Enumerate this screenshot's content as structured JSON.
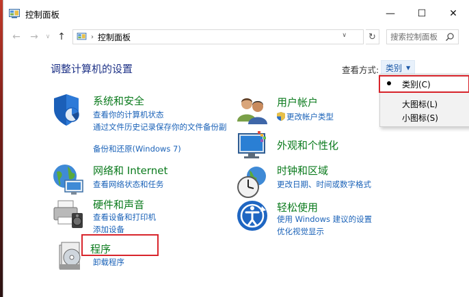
{
  "window": {
    "title": "控制面板"
  },
  "caption": {
    "minimize": "—",
    "maximize": "☐",
    "close": "✕"
  },
  "nav": {
    "back": "←",
    "forward": "→",
    "recent": "∨",
    "up": "↑",
    "address_sep": "›",
    "address_text": "控制面板",
    "address_dropdown": "∨",
    "refresh": "↻",
    "search_placeholder": "搜索控制面板"
  },
  "main": {
    "heading": "调整计算机的设置",
    "view_by_label": "查看方式:",
    "view_by_value": "类别",
    "view_by_caret": "▼"
  },
  "view_menu": {
    "items": [
      {
        "label": "类别(C)",
        "selected": true
      },
      {
        "label": "大图标(L)",
        "selected": false
      },
      {
        "label": "小图标(S)",
        "selected": false
      }
    ]
  },
  "categories": {
    "system": {
      "title": "系统和安全",
      "links": [
        "查看你的计算机状态",
        "通过文件历史记录保存你的文件备份副",
        "备份和还原(Windows 7)"
      ]
    },
    "network": {
      "title": "网络和 Internet",
      "links": [
        "查看网络状态和任务"
      ]
    },
    "hardware": {
      "title": "硬件和声音",
      "links": [
        "查看设备和打印机",
        "添加设备"
      ]
    },
    "programs": {
      "title": "程序",
      "links": [
        "卸载程序"
      ]
    },
    "accounts": {
      "title": "用户帐户",
      "links": [
        "更改帐户类型"
      ]
    },
    "appearance": {
      "title": "外观和个性化",
      "links": []
    },
    "clock": {
      "title": "时钟和区域",
      "links": [
        "更改日期、时间或数字格式"
      ]
    },
    "ease": {
      "title": "轻松使用",
      "links": [
        "使用 Windows 建议的设置",
        "优化视觉显示"
      ]
    }
  },
  "colors": {
    "category_title": "#0a7a1c",
    "link": "#1a62b8",
    "heading": "#1e3287",
    "annotation": "#d8242b"
  }
}
